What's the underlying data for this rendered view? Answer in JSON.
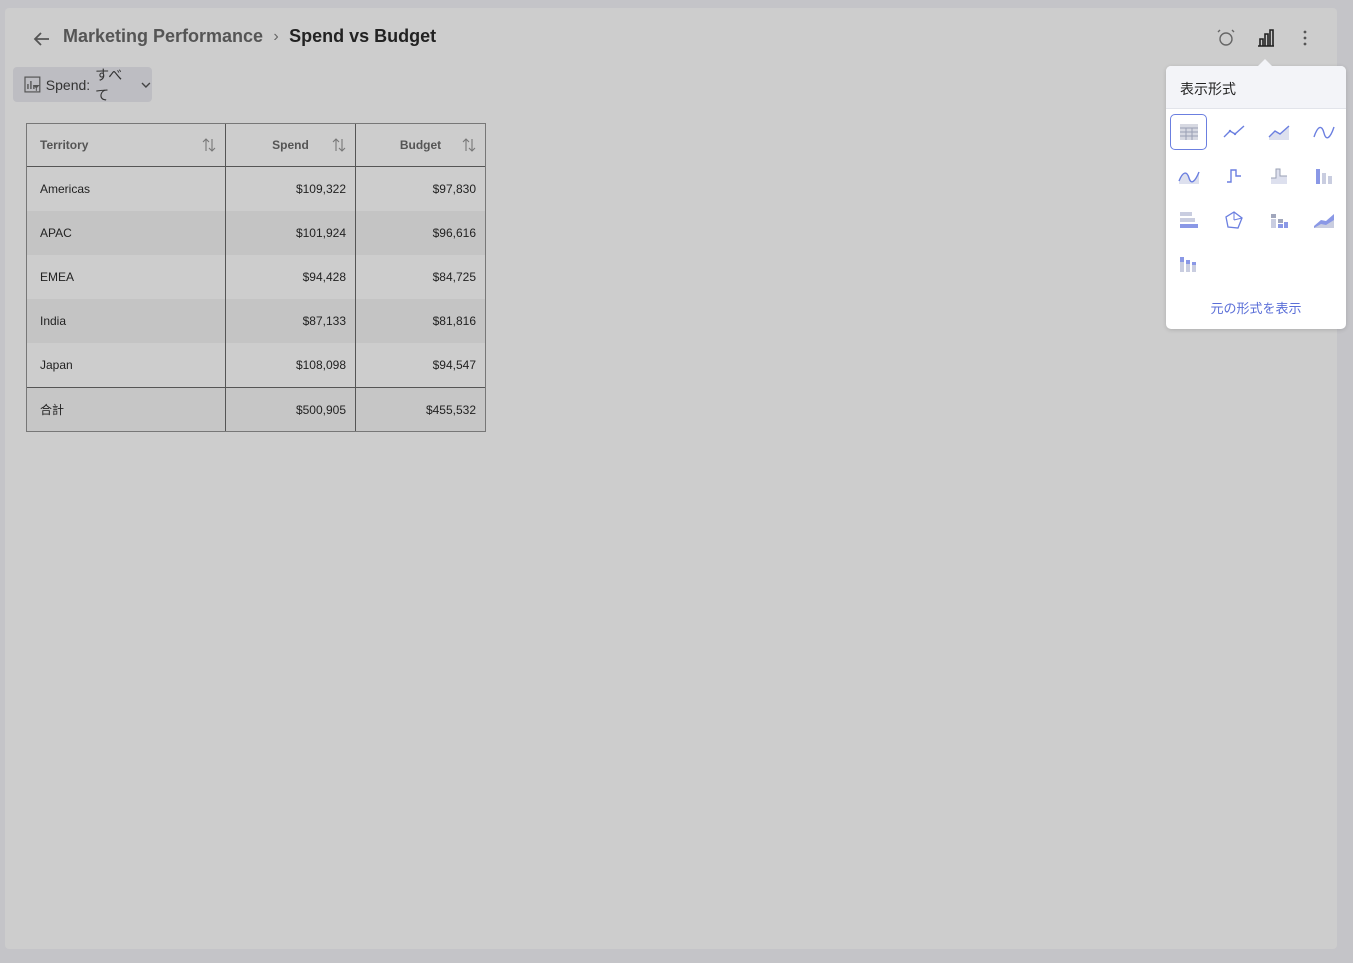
{
  "header": {
    "breadcrumb_parent": "Marketing Performance",
    "breadcrumb_sep": "›",
    "breadcrumb_current": "Spend vs Budget",
    "icons": [
      "back-arrow-icon",
      "alarm-icon",
      "chart-type-icon",
      "more-vertical-icon"
    ]
  },
  "filter": {
    "label": "Spend:",
    "value": "すべて"
  },
  "table": {
    "columns": [
      "Territory",
      "Spend",
      "Budget"
    ],
    "rows": [
      {
        "territory": "Americas",
        "spend": "$109,322",
        "budget": "$97,830"
      },
      {
        "territory": "APAC",
        "spend": "$101,924",
        "budget": "$96,616"
      },
      {
        "territory": "EMEA",
        "spend": "$94,428",
        "budget": "$84,725"
      },
      {
        "territory": "India",
        "spend": "$87,133",
        "budget": "$81,816"
      },
      {
        "territory": "Japan",
        "spend": "$108,098",
        "budget": "$94,547"
      }
    ],
    "total": {
      "label": "合計",
      "spend": "$500,905",
      "budget": "$455,532"
    }
  },
  "popover": {
    "title": "表示形式",
    "show_original": "元の形式を表示",
    "selected": "grid",
    "types": [
      "grid",
      "line",
      "area",
      "spline",
      "spline-area",
      "step-line",
      "step-area",
      "column",
      "bar",
      "pie",
      "stacked-column",
      "stacked-area",
      "stacked-bar"
    ]
  },
  "colors": {
    "accent": "#6b7fe0",
    "link": "#5b6fd8",
    "background": "#cdcdcd"
  }
}
